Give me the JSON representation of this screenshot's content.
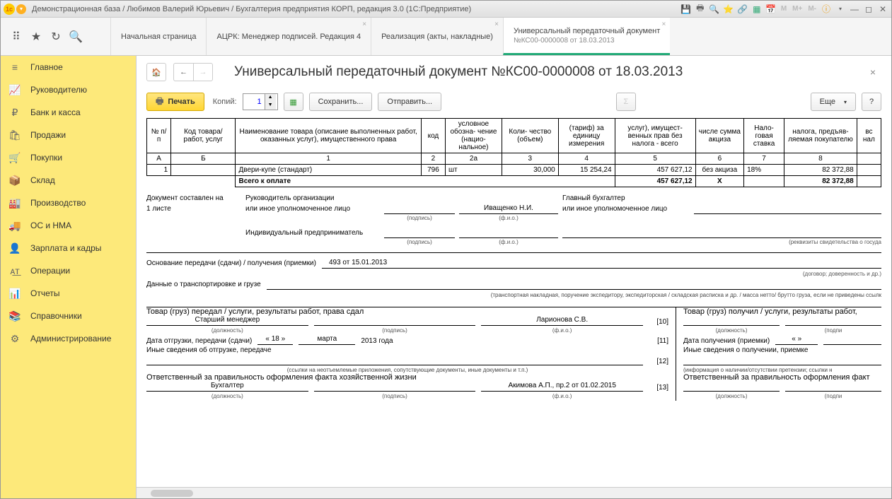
{
  "titlebar": {
    "text": "Демонстрационная база / Любимов Валерий Юрьевич / Бухгалтерия предприятия КОРП, редакция 3.0  (1С:Предприятие)"
  },
  "tabs": [
    {
      "label": "Начальная страница"
    },
    {
      "label": "АЦРК: Менеджер подписей. Редакция 4"
    },
    {
      "label": "Реализация (акты, накладные)"
    },
    {
      "label": "Универсальный передаточный документ",
      "sub": "№КС00-0000008 от 18.03.2013",
      "active": true
    }
  ],
  "sidebar": {
    "items": [
      {
        "icon": "≡",
        "label": "Главное"
      },
      {
        "icon": "📈",
        "label": "Руководителю"
      },
      {
        "icon": "₽",
        "label": "Банк и касса"
      },
      {
        "icon": "🛍",
        "label": "Продажи"
      },
      {
        "icon": "🛒",
        "label": "Покупки"
      },
      {
        "icon": "📦",
        "label": "Склад"
      },
      {
        "icon": "🏭",
        "label": "Производство"
      },
      {
        "icon": "🚚",
        "label": "ОС и НМА"
      },
      {
        "icon": "👤",
        "label": "Зарплата и кадры"
      },
      {
        "icon": "ᴀ͟ᴛ",
        "label": "Операции"
      },
      {
        "icon": "📊",
        "label": "Отчеты"
      },
      {
        "icon": "📚",
        "label": "Справочники"
      },
      {
        "icon": "⚙",
        "label": "Администрирование"
      }
    ]
  },
  "doc": {
    "title": "Универсальный передаточный документ №КС00-0000008 от 18.03.2013",
    "print": "Печать",
    "copies_label": "Копий:",
    "copies_value": "1",
    "save": "Сохранить...",
    "send": "Отправить...",
    "more": "Еще"
  },
  "table": {
    "headers": {
      "h1": "№\nп/п",
      "h2": "Код товара/\nработ, услуг",
      "h3": "Наименование товара (описание\nвыполненных работ, оказанных услуг),\nимущественного права",
      "h4": "код",
      "h5": "условное\nобозна-\nчение\n(нацио-\nнальное)",
      "h6": "Коли-\nчество\n(объем)",
      "h7": "(тариф)\nза\nединицу\nизмерения",
      "h8": "услуг),\nимущест-\nвенных прав без\nналога - всего",
      "h9": "числе\nсумма\nакциза",
      "h10": "Нало-\nговая\nставка",
      "h11": "налога,\nпредъяв-\nляемая\nпокупателю",
      "h12": "вс\nнал"
    },
    "cols": {
      "a": "А",
      "b": "Б",
      "c1": "1",
      "c2": "2",
      "c2a": "2а",
      "c3": "3",
      "c4": "4",
      "c5": "5",
      "c6": "6",
      "c7": "7",
      "c8": "8"
    },
    "row": {
      "n": "1",
      "code": "",
      "name": "Двери-купе (стандарт)",
      "kod": "796",
      "unit": "шт",
      "qty": "30,000",
      "price": "15 254,24",
      "sum": "457 627,12",
      "excise": "без акциза",
      "rate": "18%",
      "tax": "82 372,88"
    },
    "total": {
      "label": "Всего к оплате",
      "sum": "457 627,12",
      "x": "Х",
      "tax": "82 372,88"
    }
  },
  "sig": {
    "doc_pages": "Документ составлен на",
    "pages": "1 листе",
    "head_org": "Руководитель организации",
    "or_auth": "или иное уполномоченное лицо",
    "ip": "Индивидуальный предприниматель",
    "chief_acc": "Главный бухгалтер",
    "podpis": "(подпись)",
    "fio": "(ф.и.о.)",
    "head_name": "Иващенко Н.И.",
    "rekvizity": "(реквизиты свидетельства о госуда"
  },
  "transfer": {
    "basis_label": "Основание передачи (сдачи) / получения (приемки)",
    "basis_value": "493 от 15.01.2013",
    "basis_note": "(договор; доверенность и др.)",
    "cargo_label": "Данные о транспортировке и грузе",
    "cargo_note": "(транспортная накладная, поручение экспедитору, экспедиторская / складская расписка и др. / масса нетто/ брутто груза, если не приведены ссылк"
  },
  "left_block": {
    "l1": "Товар (груз) передал / услуги, результаты работ, права сдал",
    "position": "Старший менеджер",
    "position_lbl": "(должность)",
    "name": "Ларионова С.В.",
    "code10": "[10]",
    "l2": "Дата отгрузки, передачи (сдачи)",
    "date_d": "« 18 »",
    "date_m": "марта",
    "date_y": "2013  года",
    "code11": "[11]",
    "l3": "Иные сведения об отгрузке, передаче",
    "l3_note": "(ссылки на неотъемлемые приложения, сопутствующие документы, иные документы и т.п.)",
    "code12": "[12]",
    "l4": "Ответственный за правильность оформления факта хозяйственной жизни",
    "resp_pos": "Бухгалтер",
    "resp_name": "Акимова А.П., пр.2 от 01.02.2015",
    "code13": "[13]"
  },
  "right_block": {
    "r1": "Товар (груз) получил / услуги, результаты работ,",
    "r_pos_lbl": "(должность)",
    "r_podp": "(подпи",
    "r2": "Дата получения (приемки)",
    "r_date": "«         »",
    "r3": "Иные сведения о получении, приемке",
    "r3_note": "(информация о наличии/отсутствии претензии; ссылки н",
    "r4": "Ответственный за правильность оформления факт",
    "r4_pos_lbl": "(должность)"
  }
}
